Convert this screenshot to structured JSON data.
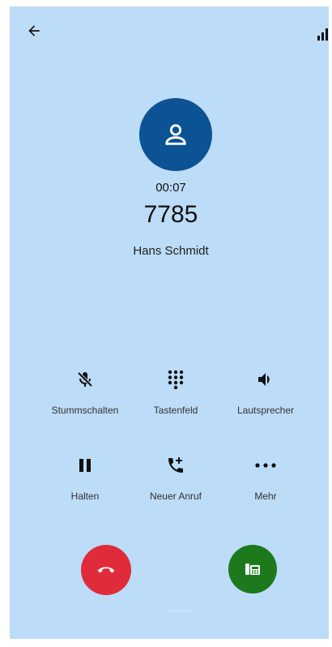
{
  "call": {
    "duration": "00:07",
    "number": "7785",
    "contact_name": "Hans Schmidt"
  },
  "controls": {
    "mute": "Stummschalten",
    "keypad": "Tastenfeld",
    "speaker": "Lautsprecher",
    "hold": "Halten",
    "new_call": "Neuer Anruf",
    "more": "Mehr"
  },
  "icons": {
    "back": "arrow-left-icon",
    "signal": "signal-bars-icon",
    "avatar": "person-icon",
    "mute": "mic-off-icon",
    "keypad": "dialpad-icon",
    "speaker": "volume-icon",
    "hold": "pause-icon",
    "new_call": "add-call-icon",
    "more": "more-horizontal-icon",
    "end_call": "call-end-icon",
    "transfer": "desk-phone-icon"
  },
  "colors": {
    "background": "#bcdcf7",
    "avatar": "#0b5394",
    "end_call": "#e02b3b",
    "transfer": "#1c7a1c"
  }
}
